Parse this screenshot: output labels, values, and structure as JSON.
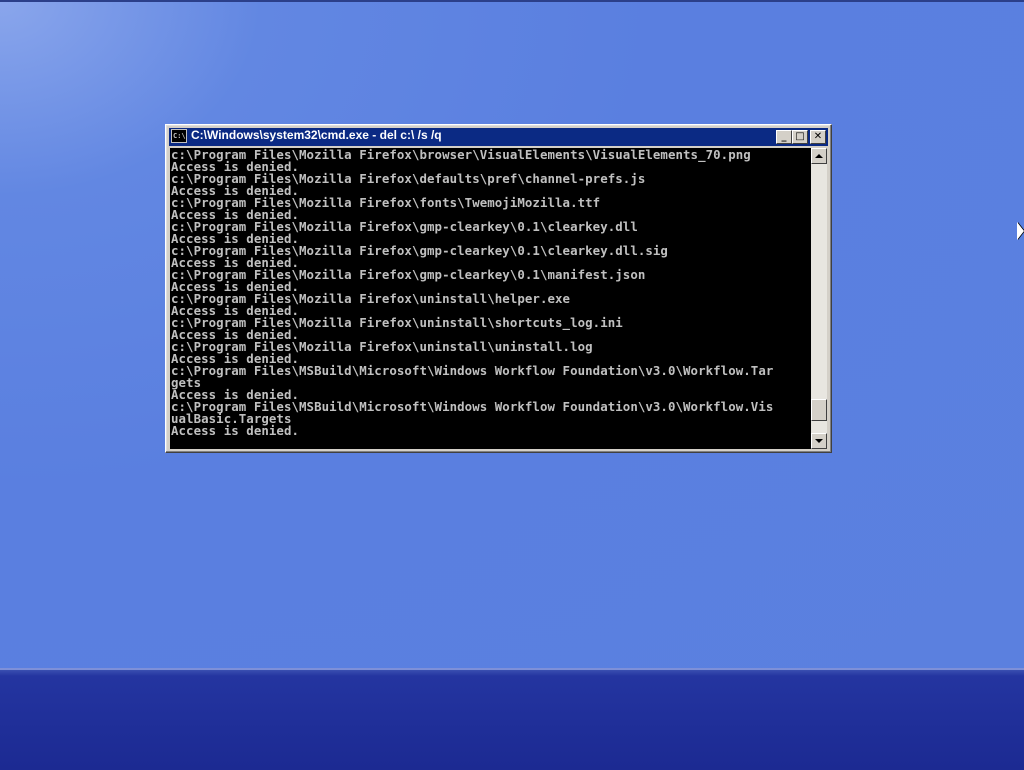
{
  "window": {
    "title": "C:\\Windows\\system32\\cmd.exe - del  c:\\ /s /q",
    "icon_label": "C:\\",
    "minimize_label": "_",
    "maximize_label": "□",
    "close_label": "✕"
  },
  "console": {
    "lines": [
      "c:\\Program Files\\Mozilla Firefox\\browser\\VisualElements\\VisualElements_70.png",
      "Access is denied.",
      "c:\\Program Files\\Mozilla Firefox\\defaults\\pref\\channel-prefs.js",
      "Access is denied.",
      "c:\\Program Files\\Mozilla Firefox\\fonts\\TwemojiMozilla.ttf",
      "Access is denied.",
      "c:\\Program Files\\Mozilla Firefox\\gmp-clearkey\\0.1\\clearkey.dll",
      "Access is denied.",
      "c:\\Program Files\\Mozilla Firefox\\gmp-clearkey\\0.1\\clearkey.dll.sig",
      "Access is denied.",
      "c:\\Program Files\\Mozilla Firefox\\gmp-clearkey\\0.1\\manifest.json",
      "Access is denied.",
      "c:\\Program Files\\Mozilla Firefox\\uninstall\\helper.exe",
      "Access is denied.",
      "c:\\Program Files\\Mozilla Firefox\\uninstall\\shortcuts_log.ini",
      "Access is denied.",
      "c:\\Program Files\\Mozilla Firefox\\uninstall\\uninstall.log",
      "Access is denied.",
      "c:\\Program Files\\MSBuild\\Microsoft\\Windows Workflow Foundation\\v3.0\\Workflow.Tar",
      "gets",
      "Access is denied.",
      "c:\\Program Files\\MSBuild\\Microsoft\\Windows Workflow Foundation\\v3.0\\Workflow.Vis",
      "ualBasic.Targets",
      "Access is denied."
    ]
  },
  "scrollbar": {
    "position": 0.95
  },
  "colors": {
    "desktop": "#5b80df",
    "taskbar": "#1f2e98",
    "titlebar": "#0b2a84",
    "console_bg": "#000000",
    "console_text": "#c0c0c0"
  },
  "icons": {
    "window_icon": "cmd-icon",
    "minimize": "minimize-icon",
    "maximize": "maximize-icon",
    "close": "close-icon",
    "cursor": "mouse-pointer-icon"
  }
}
